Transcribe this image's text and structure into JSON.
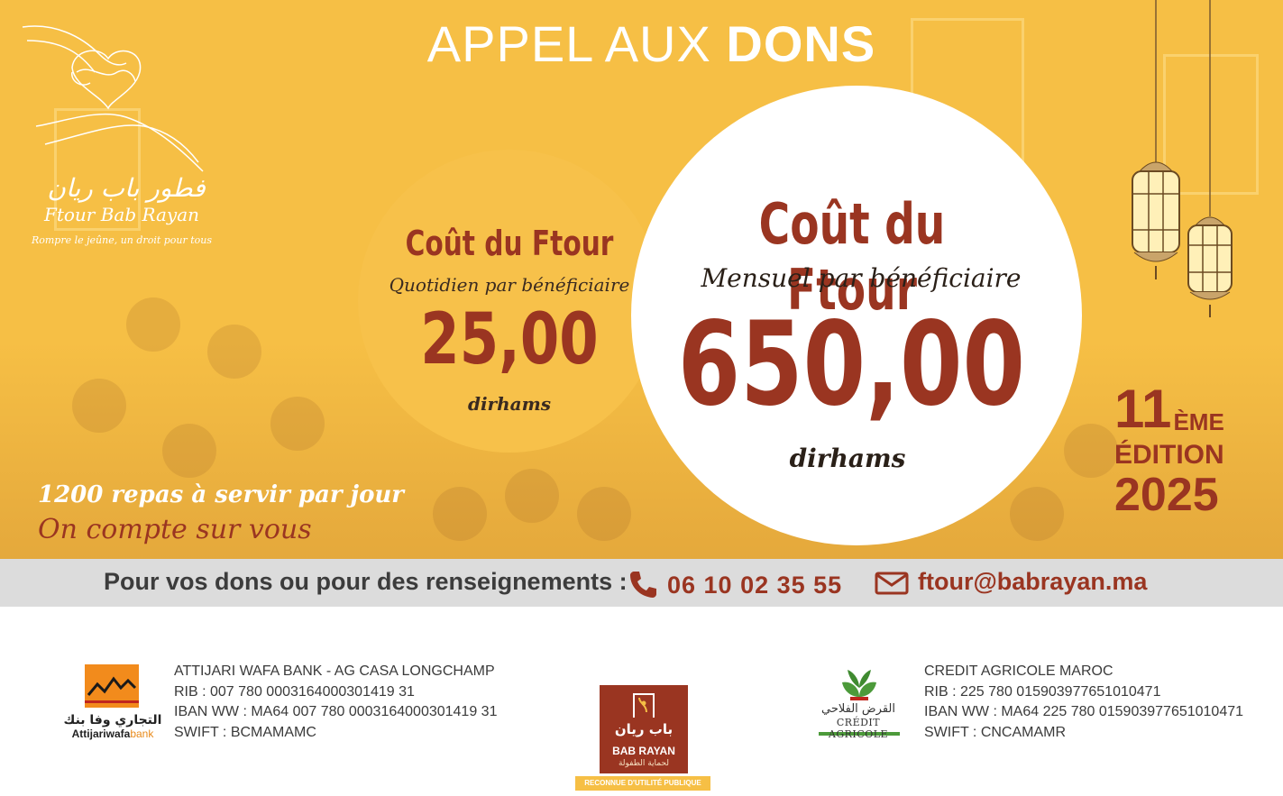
{
  "colors": {
    "banner": "#f6bf45",
    "accent": "#9a3521",
    "contact_bar": "#dcdcdc",
    "text_dark": "#3c3c3c"
  },
  "header": {
    "title_light": "APPEL AUX ",
    "title_bold": "DONS"
  },
  "logo": {
    "arabic": "فطور باب ريان",
    "name": "Ftour Bab Rayan",
    "tagline": "Rompre le jeûne, un droit pour tous",
    "icon": "hands-heart-icon"
  },
  "daily": {
    "title": "Coût du Ftour",
    "subtitle": "Quotidien par bénéficiaire",
    "value": "25,00",
    "unit": "dirhams"
  },
  "monthly": {
    "title": "Coût du Ftour",
    "subtitle": "Mensuel par bénéficiaire",
    "value": "650,00",
    "unit": "dirhams"
  },
  "edition": {
    "number": "11",
    "suffix": "ÈME",
    "label": "ÉDITION",
    "year": "2025"
  },
  "slogan": {
    "meals": "1200 repas à servir par jour",
    "call": "On compte sur vous"
  },
  "contact": {
    "label": "Pour vos dons ou pour des renseignements :",
    "phone": "06 10 02 35 55",
    "email": "ftour@babrayan.ma",
    "phone_icon": "phone-icon",
    "email_icon": "envelope-icon"
  },
  "bank_awb": {
    "logo_arabic": "التجاري وفا بنك",
    "logo_name_bold": "Attijariwafa",
    "logo_name_light": "bank",
    "lines": [
      "ATTIJARI WAFA BANK - AG CASA LONGCHAMP",
      "RIB : 007 780 0003164000301419 31",
      "IBAN WW : MA64 007 780 0003164000301419 31",
      "SWIFT : BCMAMAMC"
    ]
  },
  "center_logo": {
    "arabic": "باب ريان",
    "name": "BAB RAYAN",
    "subtitle": "لحماية الطفولة",
    "badge": "RECONNUE D'UTILITÉ PUBLIQUE"
  },
  "bank_ca": {
    "logo_arabic": "القرض الفلاحي",
    "logo_name": "CRÉDIT AGRICOLE",
    "lines": [
      "CREDIT AGRICOLE MAROC",
      "RIB : 225 780 015903977651010471",
      "IBAN WW : MA64 225 780 015903977651010471",
      "SWIFT : CNCAMAMR"
    ]
  }
}
